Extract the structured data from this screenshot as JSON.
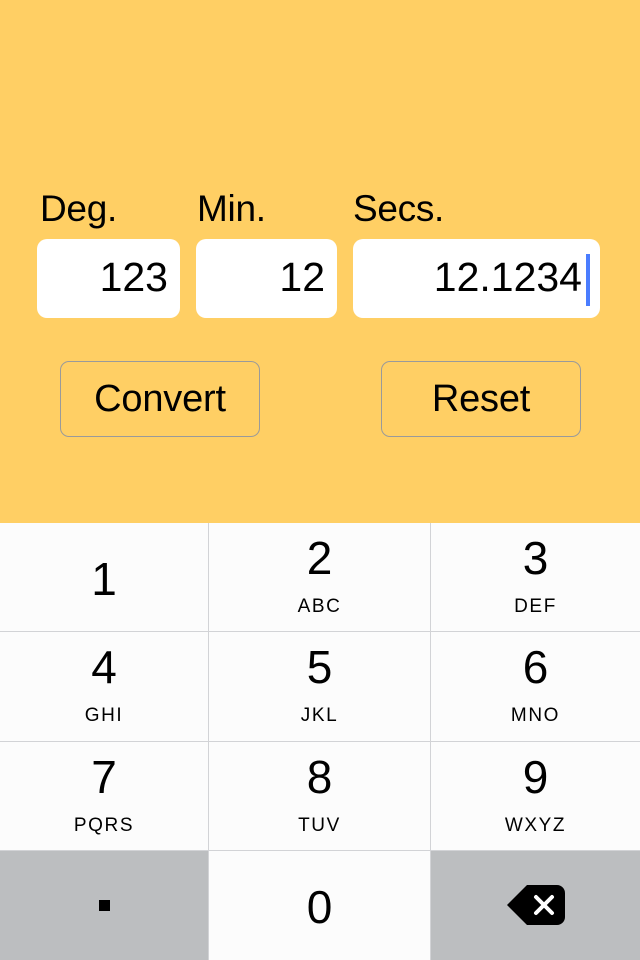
{
  "theme": {
    "background": "#ffcf64",
    "field_background": "#ffffff",
    "caret_color": "#4a7dff",
    "key_background": "#fcfcfc",
    "key_gray_background": "#bcbec0",
    "key_divider": "#d2d3d6",
    "text_color": "#000000",
    "button_border": "#9a9a9a"
  },
  "form": {
    "fields": [
      {
        "label": "Deg.",
        "value": "123",
        "name": "degrees",
        "focused": false
      },
      {
        "label": "Min.",
        "value": "12",
        "name": "minutes",
        "focused": false
      },
      {
        "label": "Secs.",
        "value": "12.1234",
        "name": "seconds",
        "focused": true
      }
    ],
    "buttons": {
      "convert": "Convert",
      "reset": "Reset"
    }
  },
  "keyboard": {
    "type": "numeric-phone-pad",
    "rows": [
      [
        {
          "digit": "1",
          "letters": "",
          "style": "light",
          "icon": ""
        },
        {
          "digit": "2",
          "letters": "ABC",
          "style": "light",
          "icon": ""
        },
        {
          "digit": "3",
          "letters": "DEF",
          "style": "light",
          "icon": ""
        }
      ],
      [
        {
          "digit": "4",
          "letters": "GHI",
          "style": "light",
          "icon": ""
        },
        {
          "digit": "5",
          "letters": "JKL",
          "style": "light",
          "icon": ""
        },
        {
          "digit": "6",
          "letters": "MNO",
          "style": "light",
          "icon": ""
        }
      ],
      [
        {
          "digit": "7",
          "letters": "PQRS",
          "style": "light",
          "icon": ""
        },
        {
          "digit": "8",
          "letters": "TUV",
          "style": "light",
          "icon": ""
        },
        {
          "digit": "9",
          "letters": "WXYZ",
          "style": "light",
          "icon": ""
        }
      ],
      [
        {
          "digit": ".",
          "letters": "",
          "style": "gray",
          "icon": "period-icon"
        },
        {
          "digit": "0",
          "letters": "",
          "style": "light",
          "icon": ""
        },
        {
          "digit": "",
          "letters": "",
          "style": "gray",
          "icon": "backspace-icon"
        }
      ]
    ]
  }
}
